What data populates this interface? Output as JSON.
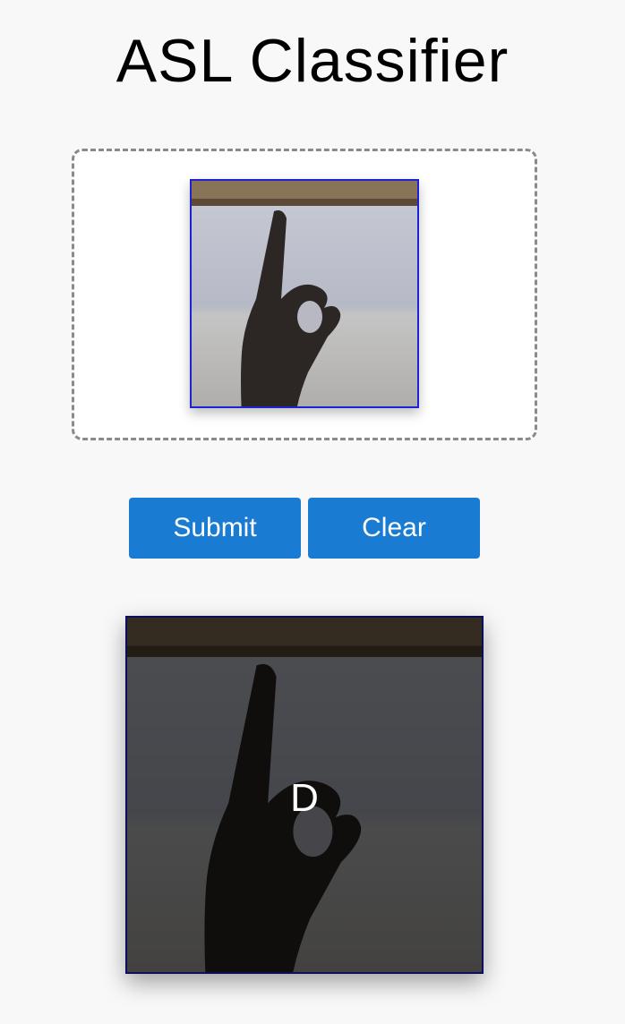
{
  "header": {
    "title": "ASL Classifier"
  },
  "upload": {
    "image_alt": "uploaded hand sign image"
  },
  "actions": {
    "submit_label": "Submit",
    "clear_label": "Clear"
  },
  "result": {
    "prediction": "D",
    "image_alt": "classified hand sign image"
  },
  "colors": {
    "button": "#1a7bd2",
    "thumb_border": "#1e22d6",
    "result_border": "#0c0f5c"
  }
}
